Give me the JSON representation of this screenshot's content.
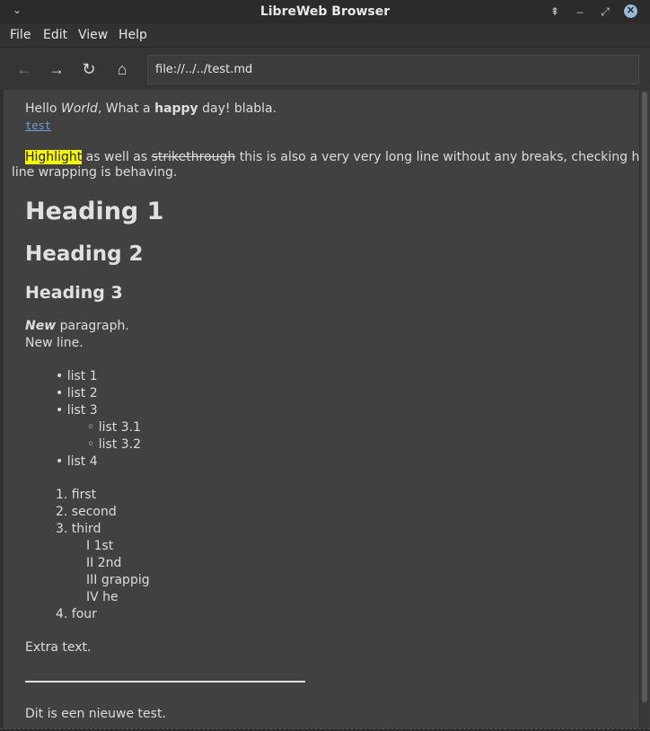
{
  "window": {
    "title": "LibreWeb Browser",
    "menu_icon": "chevron-down-icon",
    "pin_icon": "pin-icon",
    "minimize_icon": "minimize-icon",
    "maximize_icon": "maximize-icon",
    "close_icon": "close-icon"
  },
  "menubar": {
    "items": [
      "File",
      "Edit",
      "View",
      "Help"
    ]
  },
  "toolbar": {
    "back_icon": "arrow-left-icon",
    "forward_icon": "arrow-right-icon",
    "reload_icon": "reload-icon",
    "home_icon": "home-icon",
    "address": "file://../../test.md"
  },
  "content": {
    "line1": {
      "a": "Hello ",
      "b": "World",
      "c": ", What a ",
      "d": "happy",
      "e": " day! blabla."
    },
    "link": "test",
    "para2": {
      "highlight": "Highlight",
      "a": " as well as ",
      "strike": "strikethrough",
      "b": " this is also a very very long line without any breaks, checking how",
      "c": "line wrapping is behaving."
    },
    "heading1": "Heading 1",
    "heading2": "Heading 2",
    "heading3": "Heading 3",
    "para3": {
      "bold_italic": "New",
      "a": " paragraph.",
      "b": "New line."
    },
    "bullets": [
      "• list 1",
      "• list 2",
      "• list 3",
      "◦ list 3.1",
      "◦ list 3.2",
      "• list 4"
    ],
    "ordered": [
      "1. first",
      "2. second",
      "3. third",
      "I 1st",
      "II 2nd",
      "III grappig",
      "IV he",
      "4. four"
    ],
    "extra": "Extra text.",
    "last": "Dit is een nieuwe test."
  },
  "colors": {
    "highlight": "#f7f700",
    "link": "#6aa1d8",
    "background": "#414141"
  }
}
